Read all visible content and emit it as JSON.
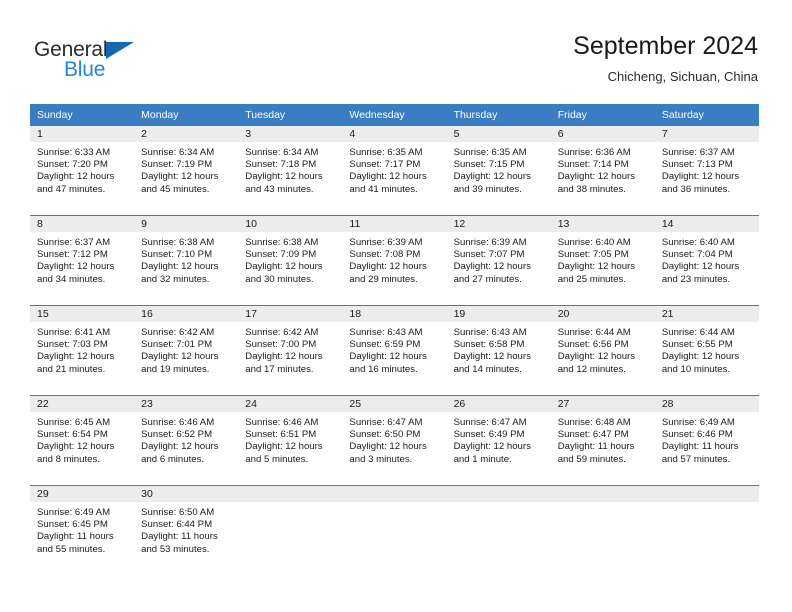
{
  "brand": {
    "name_line1": "General",
    "name_line2": "Blue",
    "colors": {
      "text_dark": "#2b2b2b",
      "triangle": "#1268b3",
      "blue_text": "#2a86d0"
    }
  },
  "header": {
    "title": "September 2024",
    "subtitle": "Chicheng, Sichuan, China"
  },
  "theme": {
    "header_blue": "#3a7dc2",
    "daynum_band": "#ececec",
    "cell_background": "#ffffff",
    "text": "#1c1c1c"
  },
  "weekdays": [
    "Sunday",
    "Monday",
    "Tuesday",
    "Wednesday",
    "Thursday",
    "Friday",
    "Saturday"
  ],
  "weeks": [
    [
      {
        "day": "1",
        "sunrise": "Sunrise: 6:33 AM",
        "sunset": "Sunset: 7:20 PM",
        "daylight1": "Daylight: 12 hours",
        "daylight2": "and 47 minutes."
      },
      {
        "day": "2",
        "sunrise": "Sunrise: 6:34 AM",
        "sunset": "Sunset: 7:19 PM",
        "daylight1": "Daylight: 12 hours",
        "daylight2": "and 45 minutes."
      },
      {
        "day": "3",
        "sunrise": "Sunrise: 6:34 AM",
        "sunset": "Sunset: 7:18 PM",
        "daylight1": "Daylight: 12 hours",
        "daylight2": "and 43 minutes."
      },
      {
        "day": "4",
        "sunrise": "Sunrise: 6:35 AM",
        "sunset": "Sunset: 7:17 PM",
        "daylight1": "Daylight: 12 hours",
        "daylight2": "and 41 minutes."
      },
      {
        "day": "5",
        "sunrise": "Sunrise: 6:35 AM",
        "sunset": "Sunset: 7:15 PM",
        "daylight1": "Daylight: 12 hours",
        "daylight2": "and 39 minutes."
      },
      {
        "day": "6",
        "sunrise": "Sunrise: 6:36 AM",
        "sunset": "Sunset: 7:14 PM",
        "daylight1": "Daylight: 12 hours",
        "daylight2": "and 38 minutes."
      },
      {
        "day": "7",
        "sunrise": "Sunrise: 6:37 AM",
        "sunset": "Sunset: 7:13 PM",
        "daylight1": "Daylight: 12 hours",
        "daylight2": "and 36 minutes."
      }
    ],
    [
      {
        "day": "8",
        "sunrise": "Sunrise: 6:37 AM",
        "sunset": "Sunset: 7:12 PM",
        "daylight1": "Daylight: 12 hours",
        "daylight2": "and 34 minutes."
      },
      {
        "day": "9",
        "sunrise": "Sunrise: 6:38 AM",
        "sunset": "Sunset: 7:10 PM",
        "daylight1": "Daylight: 12 hours",
        "daylight2": "and 32 minutes."
      },
      {
        "day": "10",
        "sunrise": "Sunrise: 6:38 AM",
        "sunset": "Sunset: 7:09 PM",
        "daylight1": "Daylight: 12 hours",
        "daylight2": "and 30 minutes."
      },
      {
        "day": "11",
        "sunrise": "Sunrise: 6:39 AM",
        "sunset": "Sunset: 7:08 PM",
        "daylight1": "Daylight: 12 hours",
        "daylight2": "and 29 minutes."
      },
      {
        "day": "12",
        "sunrise": "Sunrise: 6:39 AM",
        "sunset": "Sunset: 7:07 PM",
        "daylight1": "Daylight: 12 hours",
        "daylight2": "and 27 minutes."
      },
      {
        "day": "13",
        "sunrise": "Sunrise: 6:40 AM",
        "sunset": "Sunset: 7:05 PM",
        "daylight1": "Daylight: 12 hours",
        "daylight2": "and 25 minutes."
      },
      {
        "day": "14",
        "sunrise": "Sunrise: 6:40 AM",
        "sunset": "Sunset: 7:04 PM",
        "daylight1": "Daylight: 12 hours",
        "daylight2": "and 23 minutes."
      }
    ],
    [
      {
        "day": "15",
        "sunrise": "Sunrise: 6:41 AM",
        "sunset": "Sunset: 7:03 PM",
        "daylight1": "Daylight: 12 hours",
        "daylight2": "and 21 minutes."
      },
      {
        "day": "16",
        "sunrise": "Sunrise: 6:42 AM",
        "sunset": "Sunset: 7:01 PM",
        "daylight1": "Daylight: 12 hours",
        "daylight2": "and 19 minutes."
      },
      {
        "day": "17",
        "sunrise": "Sunrise: 6:42 AM",
        "sunset": "Sunset: 7:00 PM",
        "daylight1": "Daylight: 12 hours",
        "daylight2": "and 17 minutes."
      },
      {
        "day": "18",
        "sunrise": "Sunrise: 6:43 AM",
        "sunset": "Sunset: 6:59 PM",
        "daylight1": "Daylight: 12 hours",
        "daylight2": "and 16 minutes."
      },
      {
        "day": "19",
        "sunrise": "Sunrise: 6:43 AM",
        "sunset": "Sunset: 6:58 PM",
        "daylight1": "Daylight: 12 hours",
        "daylight2": "and 14 minutes."
      },
      {
        "day": "20",
        "sunrise": "Sunrise: 6:44 AM",
        "sunset": "Sunset: 6:56 PM",
        "daylight1": "Daylight: 12 hours",
        "daylight2": "and 12 minutes."
      },
      {
        "day": "21",
        "sunrise": "Sunrise: 6:44 AM",
        "sunset": "Sunset: 6:55 PM",
        "daylight1": "Daylight: 12 hours",
        "daylight2": "and 10 minutes."
      }
    ],
    [
      {
        "day": "22",
        "sunrise": "Sunrise: 6:45 AM",
        "sunset": "Sunset: 6:54 PM",
        "daylight1": "Daylight: 12 hours",
        "daylight2": "and 8 minutes."
      },
      {
        "day": "23",
        "sunrise": "Sunrise: 6:46 AM",
        "sunset": "Sunset: 6:52 PM",
        "daylight1": "Daylight: 12 hours",
        "daylight2": "and 6 minutes."
      },
      {
        "day": "24",
        "sunrise": "Sunrise: 6:46 AM",
        "sunset": "Sunset: 6:51 PM",
        "daylight1": "Daylight: 12 hours",
        "daylight2": "and 5 minutes."
      },
      {
        "day": "25",
        "sunrise": "Sunrise: 6:47 AM",
        "sunset": "Sunset: 6:50 PM",
        "daylight1": "Daylight: 12 hours",
        "daylight2": "and 3 minutes."
      },
      {
        "day": "26",
        "sunrise": "Sunrise: 6:47 AM",
        "sunset": "Sunset: 6:49 PM",
        "daylight1": "Daylight: 12 hours",
        "daylight2": "and 1 minute."
      },
      {
        "day": "27",
        "sunrise": "Sunrise: 6:48 AM",
        "sunset": "Sunset: 6:47 PM",
        "daylight1": "Daylight: 11 hours",
        "daylight2": "and 59 minutes."
      },
      {
        "day": "28",
        "sunrise": "Sunrise: 6:49 AM",
        "sunset": "Sunset: 6:46 PM",
        "daylight1": "Daylight: 11 hours",
        "daylight2": "and 57 minutes."
      }
    ],
    [
      {
        "day": "29",
        "sunrise": "Sunrise: 6:49 AM",
        "sunset": "Sunset: 6:45 PM",
        "daylight1": "Daylight: 11 hours",
        "daylight2": "and 55 minutes."
      },
      {
        "day": "30",
        "sunrise": "Sunrise: 6:50 AM",
        "sunset": "Sunset: 6:44 PM",
        "daylight1": "Daylight: 11 hours",
        "daylight2": "and 53 minutes."
      },
      {
        "day": "",
        "sunrise": "",
        "sunset": "",
        "daylight1": "",
        "daylight2": ""
      },
      {
        "day": "",
        "sunrise": "",
        "sunset": "",
        "daylight1": "",
        "daylight2": ""
      },
      {
        "day": "",
        "sunrise": "",
        "sunset": "",
        "daylight1": "",
        "daylight2": ""
      },
      {
        "day": "",
        "sunrise": "",
        "sunset": "",
        "daylight1": "",
        "daylight2": ""
      },
      {
        "day": "",
        "sunrise": "",
        "sunset": "",
        "daylight1": "",
        "daylight2": ""
      }
    ]
  ]
}
